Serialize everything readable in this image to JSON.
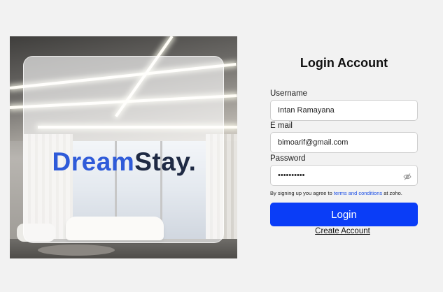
{
  "brand": {
    "part1": "Dream",
    "part2": "Stay."
  },
  "form": {
    "title": "Login Account",
    "username_label": "Username",
    "username_value": "Intan Ramayana",
    "email_label": "E mail",
    "email_value": "bimoarif@gmail.com",
    "password_label": "Password",
    "password_value": "••••••••••",
    "terms_prefix": "By signing up you agree to ",
    "terms_link": "terms and conditions",
    "terms_suffix": " at zoho.",
    "login_label": "Login",
    "create_account_label": "Create Account"
  },
  "icons": {
    "password_toggle": "eye-off-icon"
  },
  "colors": {
    "primary": "#0a3df7",
    "brand_blue": "#2f5bd9",
    "brand_dark": "#1f2a44",
    "link": "#1c4fe6"
  }
}
